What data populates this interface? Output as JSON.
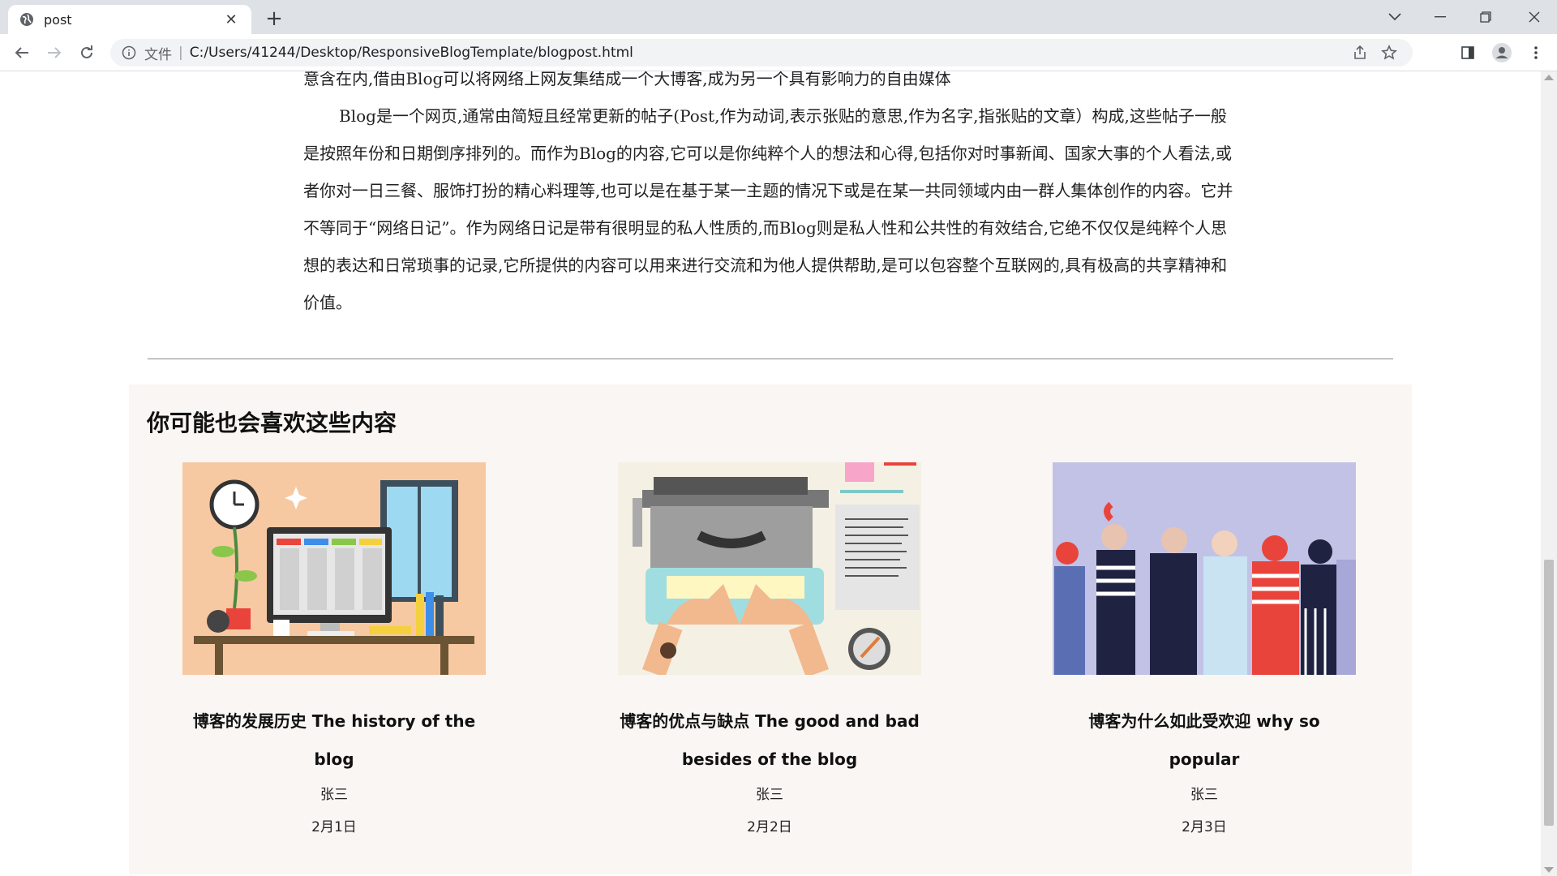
{
  "browser": {
    "tab_title": "post",
    "new_tab": "+",
    "scheme_label": "文件",
    "separator": "|",
    "url": "C:/Users/41244/Desktop/ResponsiveBlogTemplate/blogpost.html"
  },
  "article": {
    "line_top": "意含在内,借由Blog可以将网络上网友集结成一个大博客,成为另一个具有影响力的自由媒体",
    "paragraph": "Blog是一个网页,通常由简短且经常更新的帖子(Post,作为动词,表示张贴的意思,作为名字,指张贴的文章）构成,这些帖子一般是按照年份和日期倒序排列的。而作为Blog的内容,它可以是你纯粹个人的想法和心得,包括你对时事新闻、国家大事的个人看法,或者你对一日三餐、服饰打扮的精心料理等,也可以是在基于某一主题的情况下或是在某一共同领域内由一群人集体创作的内容。它并不等同于“网络日记”。作为网络日记是带有很明显的私人性质的,而Blog则是私人性和公共性的有效结合,它绝不仅仅是纯粹个人思想的表达和日常琐事的记录,它所提供的内容可以用来进行交流和为他人提供帮助,是可以包容整个互联网的,具有极高的共享精神和价值。"
  },
  "related": {
    "heading": "你可能也会喜欢这些内容",
    "cards": [
      {
        "title": "博客的发展历史 The history of the blog",
        "author": "张三",
        "date": "2月1日",
        "image_icon": "desk-workspace-illustration"
      },
      {
        "title": "博客的优点与缺点 The good and bad besides of the blog",
        "author": "张三",
        "date": "2月2日",
        "image_icon": "typewriter-illustration"
      },
      {
        "title": "博客为什么如此受欢迎 why so popular",
        "author": "张三",
        "date": "2月3日",
        "image_icon": "crowd-illustration"
      }
    ]
  },
  "colors": {
    "related_bg": "#faf6f4",
    "tabbar_bg": "#dee1e6"
  }
}
